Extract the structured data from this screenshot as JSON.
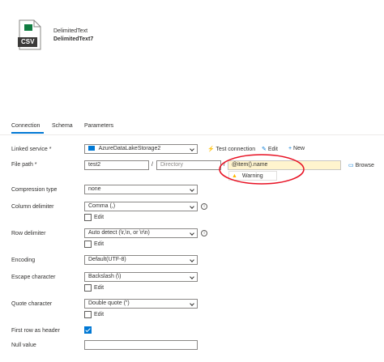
{
  "header": {
    "icon_label": "CSV",
    "dataset_type": "DelimitedText",
    "dataset_name": "DelimitedText7"
  },
  "tabs": [
    {
      "label": "Connection",
      "active": true
    },
    {
      "label": "Schema",
      "active": false
    },
    {
      "label": "Parameters",
      "active": false
    }
  ],
  "form": {
    "linked_service": {
      "label": "Linked service *",
      "value": "AzureDataLakeStorage2",
      "test_connection": "Test connection",
      "edit": "Edit",
      "new": "New"
    },
    "file_path": {
      "label": "File path *",
      "container": "test2",
      "separator1": "/",
      "directory_placeholder": "Directory",
      "separator2": "/",
      "file": "@item().name",
      "browse": "Browse",
      "warning": "Warning"
    },
    "compression_type": {
      "label": "Compression type",
      "value": "none"
    },
    "column_delimiter": {
      "label": "Column delimiter",
      "value": "Comma (,)",
      "edit": "Edit"
    },
    "row_delimiter": {
      "label": "Row delimiter",
      "value": "Auto detect (\\r,\\n, or \\r\\n)",
      "edit": "Edit"
    },
    "encoding": {
      "label": "Encoding",
      "value": "Default(UTF-8)"
    },
    "escape_character": {
      "label": "Escape character",
      "value": "Backslash (\\)",
      "edit": "Edit"
    },
    "quote_character": {
      "label": "Quote character",
      "value": "Double quote (\")",
      "edit": "Edit"
    },
    "first_row_header": {
      "label": "First row as header",
      "checked": true
    },
    "null_value": {
      "label": "Null value",
      "value": ""
    }
  },
  "colors": {
    "accent": "#0078d4",
    "annotation": "#e81123",
    "warning": "#ffb900"
  }
}
